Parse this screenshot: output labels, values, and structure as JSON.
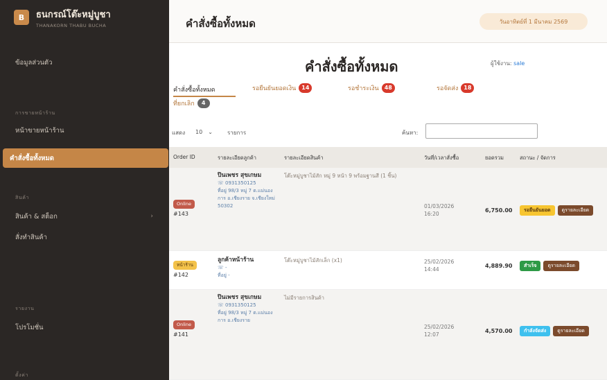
{
  "sidebar": {
    "brand_title": "ธนกรณ์โต๊ะหมู่บูชา",
    "brand_sub": "THANAKORN THABU BUCHA",
    "brand_logo": "B",
    "items": [
      {
        "label": "ข้อมูลส่วนตัว"
      },
      {
        "label": "หน้าขายหน้าร้าน"
      },
      {
        "label": "คำสั่งซื้อทั้งหมด"
      },
      {
        "label": "สินค้า & สต็อก"
      },
      {
        "label": "สั่งทำสินค้า"
      },
      {
        "label": "โปรโมชั่น"
      }
    ],
    "sections": [
      "การขายหน้าร้าน",
      "สินค้า",
      "รายงาน",
      "ตั้งค่า"
    ]
  },
  "topbar": {
    "title": "คำสั่งซื้อทั้งหมด",
    "date": "วันอาทิตย์ที่ 1 มีนาคม 2569"
  },
  "main": {
    "title": "คำสั่งซื้อทั้งหมด",
    "seller_label": "ผู้ใช้งาน:",
    "seller_name": "sale",
    "tabs": [
      {
        "label": "คำสั่งซื้อทั้งหมด",
        "count": ""
      },
      {
        "label": "รอยืนยันยอดเงิน",
        "count": "14"
      },
      {
        "label": "รอชำระเงิน",
        "count": "48"
      },
      {
        "label": "รอจัดส่ง",
        "count": "18"
      },
      {
        "label": "ที่ยกเลิก",
        "count": "4"
      }
    ],
    "show_label": "แสดง",
    "show_value": "10",
    "show_unit": "รายการ",
    "search_label": "ค้นหา:",
    "search_value": ""
  },
  "table": {
    "headers": [
      "Order ID",
      "รายละเอียดลูกค้า",
      "รายละเอียดสินค้า",
      "วันที่/เวลาสั่งซื้อ",
      "ยอดรวม",
      "สถานะ / จัดการ"
    ],
    "rows": [
      {
        "channel": "Online",
        "order": "#143",
        "customer": "ปินเพชร สุขเกษม",
        "phone": "0931350125",
        "address": "ที่อยู่ 98/3 หมู่ 7 ต.แม่นองการ อ.เชียงราย จ.เชียงใหม่ 50302",
        "product": "โต๊ะหมู่บูชาไม้สัก หมู่ 9 หน้า 9 พร้อมฐานสี (1 ชิ้น)",
        "date": "01/03/2026",
        "time": "16:20",
        "amount": "6,750.00",
        "status": "รอยืนยันยอด",
        "action": "ดูรายละเอียด"
      },
      {
        "channel": "หน้าร้าน",
        "order": "#142",
        "customer": "ลูกค้าหน้าร้าน",
        "phone": "-",
        "address": "ที่อยู่ -",
        "product": "โต๊ะหมู่บูชาไม้สักเล็ก (x1)",
        "date": "25/02/2026",
        "time": "14:44",
        "amount": "4,889.90",
        "status": "สำเร็จ",
        "action": "ดูรายละเอียด"
      },
      {
        "channel": "Online",
        "order": "#141",
        "customer": "ปินเพชร สุขเกษม",
        "phone": "0931350125",
        "address": "ที่อยู่ 98/3 หมู่ 7 ต.แม่นองการ อ.เชียงราย",
        "product": "ไม่มีรายการสินค้า",
        "date": "25/02/2026",
        "time": "12:07",
        "amount": "4,570.00",
        "status": "กำลังจัดส่ง",
        "action": "ดูรายละเอียด"
      }
    ]
  }
}
